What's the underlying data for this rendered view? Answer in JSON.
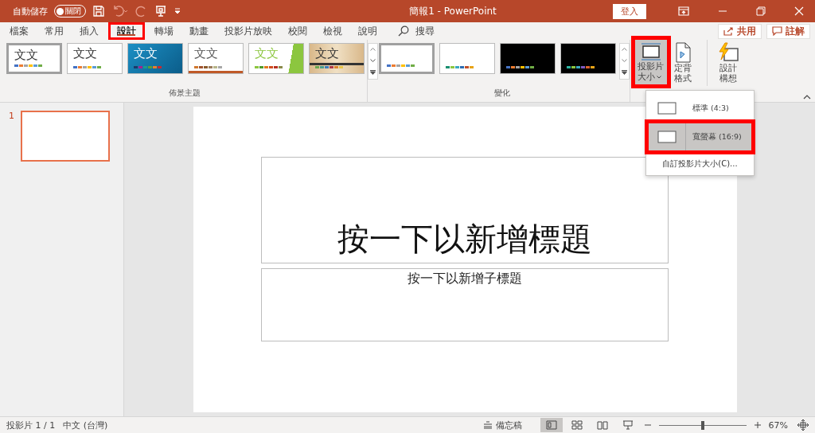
{
  "title_bar": {
    "autosave_label": "自動儲存",
    "autosave_toggle": {
      "label": "關閉",
      "on": false
    },
    "title": "簡報1 - PowerPoint",
    "sign_in": "登入"
  },
  "tabs": [
    {
      "label": "檔案",
      "selected": false,
      "highlighted": false
    },
    {
      "label": "常用",
      "selected": false,
      "highlighted": false
    },
    {
      "label": "插入",
      "selected": false,
      "highlighted": false
    },
    {
      "label": "設計",
      "selected": true,
      "highlighted": true
    },
    {
      "label": "轉場",
      "selected": false,
      "highlighted": false
    },
    {
      "label": "動畫",
      "selected": false,
      "highlighted": false
    },
    {
      "label": "投影片放映",
      "selected": false,
      "highlighted": false
    },
    {
      "label": "校閱",
      "selected": false,
      "highlighted": false
    },
    {
      "label": "檢視",
      "selected": false,
      "highlighted": false
    },
    {
      "label": "說明",
      "selected": false,
      "highlighted": false
    }
  ],
  "search": {
    "label": "搜尋"
  },
  "share_button": "共用",
  "comments_button": "註解",
  "themes": {
    "group_label": "佈景主題",
    "items": [
      {
        "kind": "office",
        "label": "文文",
        "selected": true
      },
      {
        "kind": "plain",
        "label": "文文",
        "selected": false
      },
      {
        "kind": "blue",
        "label": "文文",
        "selected": false
      },
      {
        "kind": "lined",
        "label": "文文",
        "selected": false
      },
      {
        "kind": "green",
        "label": "文文",
        "selected": false
      },
      {
        "kind": "wood",
        "label": "文文",
        "selected": false
      }
    ]
  },
  "variants": {
    "group_label": "變化",
    "items": [
      {
        "kind": "white",
        "selected": true
      },
      {
        "kind": "white2",
        "selected": false
      },
      {
        "kind": "dark",
        "selected": false
      },
      {
        "kind": "dark2",
        "selected": false
      }
    ]
  },
  "customize": [
    {
      "kind": "size",
      "lines": [
        "投影片",
        "大小"
      ],
      "pressed": true,
      "highlighted": true
    },
    {
      "kind": "background",
      "lines": [
        "定背",
        "格式"
      ],
      "pressed": false,
      "highlighted": false
    },
    {
      "kind": "ideas",
      "lines": [
        "設計",
        "構想"
      ],
      "pressed": false,
      "highlighted": false
    }
  ],
  "size_menu": [
    {
      "kind": "option",
      "label": "標準 (4:3)",
      "selected": false,
      "highlighted": false
    },
    {
      "kind": "option",
      "label": "寬螢幕 (16:9)",
      "selected": true,
      "highlighted": true
    },
    {
      "kind": "command",
      "label": "自訂投影片大小(C)..."
    }
  ],
  "thumbnails": [
    {
      "number": "1",
      "selected": true
    }
  ],
  "slide": {
    "title_placeholder": "按一下以新增標題",
    "subtitle_placeholder": "按一下以新增子標題"
  },
  "status_bar": {
    "slide_count": "投影片 1 / 1",
    "language": "中文 (台灣)",
    "notes": "備忘稿",
    "views": [
      {
        "kind": "normal",
        "selected": true
      },
      {
        "kind": "sorter",
        "selected": false
      },
      {
        "kind": "reading",
        "selected": false
      },
      {
        "kind": "show",
        "selected": false
      }
    ],
    "zoom": {
      "level": 0.5,
      "label": "67%"
    }
  }
}
